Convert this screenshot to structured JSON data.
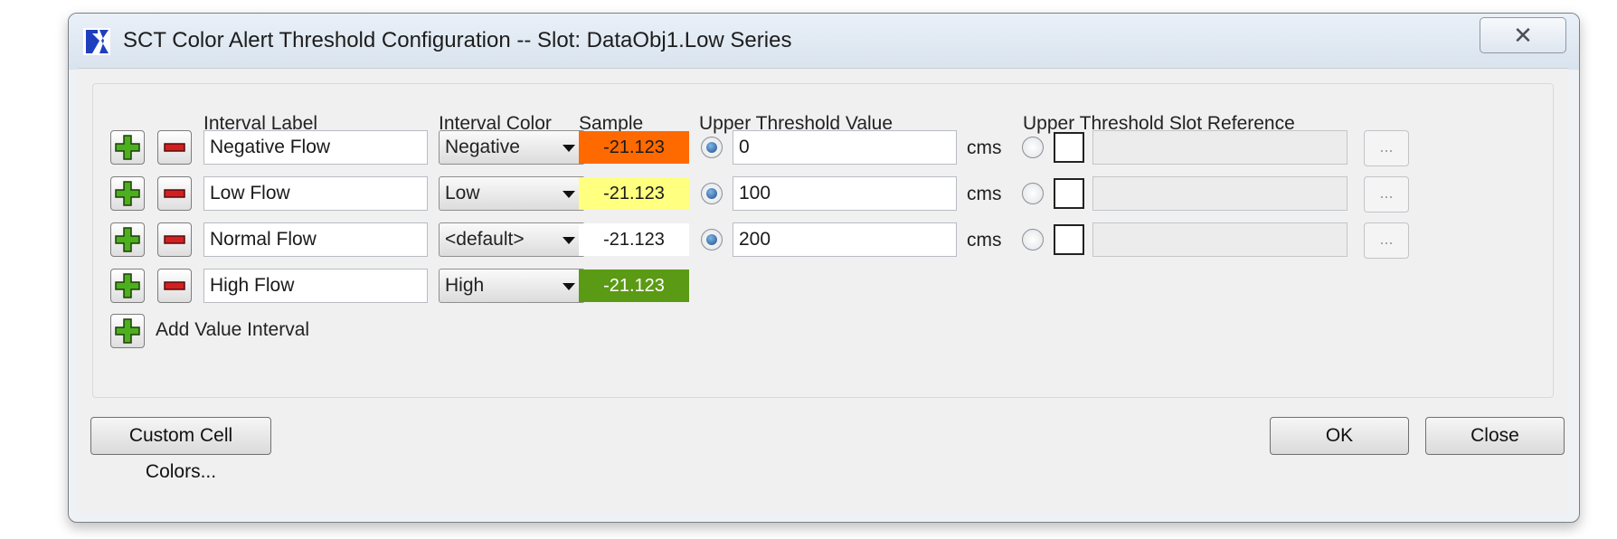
{
  "window": {
    "title": "SCT Color Alert Threshold Configuration -- Slot: DataObj1.Low Series",
    "close_glyph": "✕",
    "icon": "rw-app-icon"
  },
  "headers": {
    "interval_label": "Interval Label",
    "interval_color": "Interval Color",
    "sample": "Sample",
    "upper_threshold_value": "Upper Threshold Value",
    "upper_threshold_slot_reference": "Upper Threshold Slot Reference"
  },
  "rows": [
    {
      "label": "Negative Flow",
      "color": "Negative",
      "sample": "-21.123",
      "sample_bg": "#ff6a00",
      "sample_fg": "#1a1a1a",
      "value": "0",
      "unit": "cms",
      "dots": "..."
    },
    {
      "label": "Low Flow",
      "color": "Low",
      "sample": "-21.123",
      "sample_bg": "#ffff80",
      "sample_fg": "#1a1a1a",
      "value": "100",
      "unit": "cms",
      "dots": "..."
    },
    {
      "label": "Normal Flow",
      "color": "<default>",
      "sample": "-21.123",
      "sample_bg": "#ffffff",
      "sample_fg": "#1a1a1a",
      "value": "200",
      "unit": "cms",
      "dots": "..."
    },
    {
      "label": "High Flow",
      "color": "High",
      "sample": "-21.123",
      "sample_bg": "#5b9a14",
      "sample_fg": "#ffffff"
    }
  ],
  "add_interval_label": "Add Value Interval",
  "buttons": {
    "custom_cell_colors": "Custom Cell Colors...",
    "ok": "OK",
    "close": "Close"
  },
  "colors": {
    "plus_green": "#4caf1e",
    "minus_red": "#d22020"
  }
}
